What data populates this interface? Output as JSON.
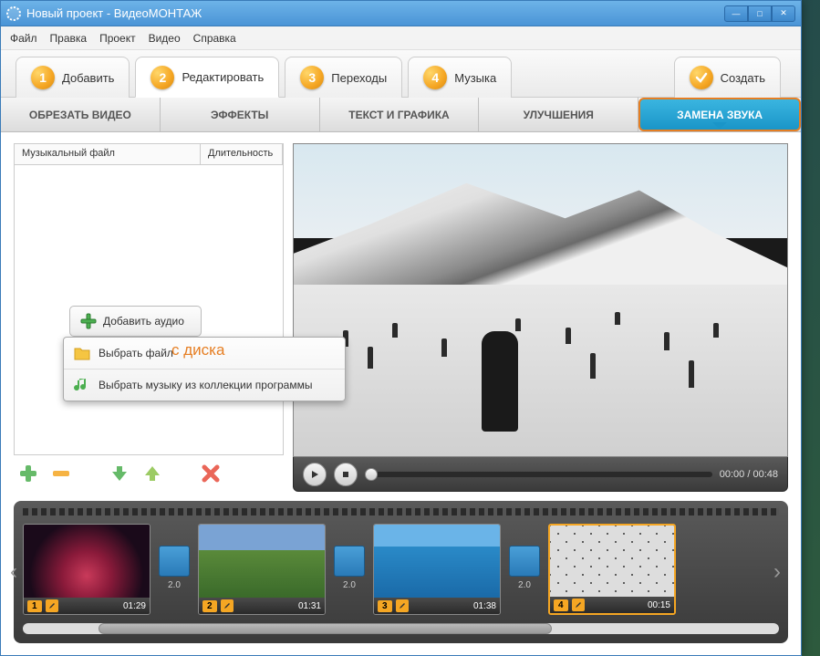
{
  "window": {
    "title": "Новый проект - ВидеоМОНТАЖ"
  },
  "menu": {
    "file": "Файл",
    "edit": "Правка",
    "project": "Проект",
    "video": "Видео",
    "help": "Справка"
  },
  "steps": {
    "add": "Добавить",
    "edit": "Редактировать",
    "transitions": "Переходы",
    "music": "Музыка",
    "create": "Создать"
  },
  "subtabs": {
    "crop": "ОБРЕЗАТЬ ВИДЕО",
    "effects": "ЭФФЕКТЫ",
    "text": "ТЕКСТ И ГРАФИКА",
    "enhance": "УЛУЧШЕНИЯ",
    "audio": "ЗАМЕНА ЗВУКА"
  },
  "audiolist": {
    "col_file": "Музыкальный файл",
    "col_duration": "Длительность"
  },
  "add_audio": {
    "label": "Добавить аудио"
  },
  "annotation": {
    "text": "с диска"
  },
  "dropdown": {
    "select_file": "Выбрать файл",
    "from_collection": "Выбрать музыку из коллекции программы"
  },
  "player": {
    "current": "00:00",
    "separator": " / ",
    "total": "00:48"
  },
  "clips": [
    {
      "num": "1",
      "time": "01:29",
      "trans": "2.0"
    },
    {
      "num": "2",
      "time": "01:31",
      "trans": "2.0"
    },
    {
      "num": "3",
      "time": "01:38",
      "trans": "2.0"
    },
    {
      "num": "4",
      "time": "00:15"
    }
  ]
}
